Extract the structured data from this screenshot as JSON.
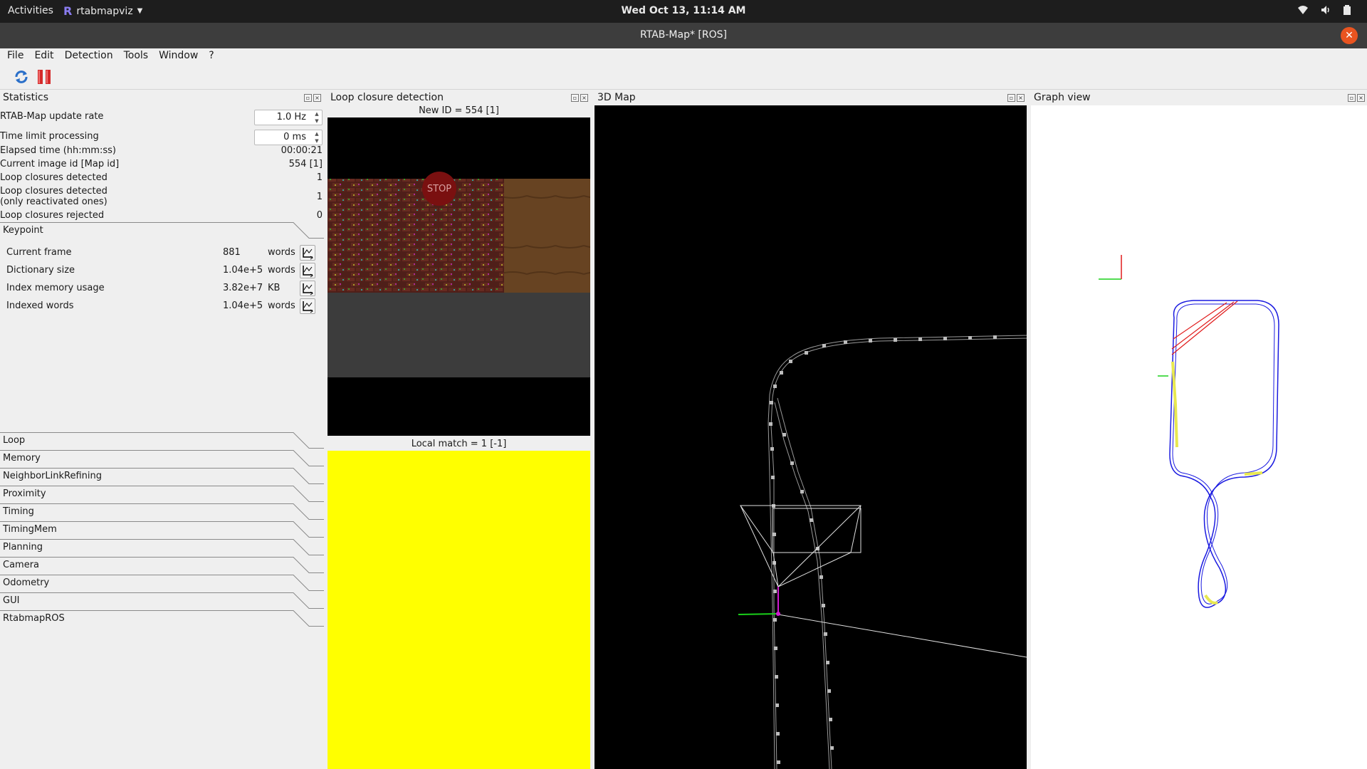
{
  "topbar": {
    "activities": "Activities",
    "app_name": "rtabmapviz",
    "clock": "Wed Oct 13, 11:14 AM"
  },
  "window": {
    "title": "RTAB-Map* [ROS]"
  },
  "menu": {
    "items": [
      "File",
      "Edit",
      "Detection",
      "Tools",
      "Window",
      "?"
    ]
  },
  "toolbar": {
    "refresh_icon": "refresh-icon",
    "pause_icon": "pause-icon"
  },
  "panels": {
    "statistics": "Statistics",
    "loop_closure": "Loop closure detection",
    "map3d": "3D Map",
    "graph": "Graph view"
  },
  "stats": {
    "update_rate_label": "RTAB-Map update rate",
    "update_rate_value": "1.0 Hz",
    "time_limit_label": "Time limit processing",
    "time_limit_value": "0 ms",
    "elapsed_label": "Elapsed time (hh:mm:ss)",
    "elapsed_value": "00:00:21",
    "image_id_label": "Current image id [Map id]",
    "image_id_value": "554 [1]",
    "loops_detected_label": "Loop closures detected",
    "loops_detected_value": "1",
    "loops_reactivated_label_1": "Loop closures detected",
    "loops_reactivated_label_2": "(only reactivated ones)",
    "loops_reactivated_value": "1",
    "loops_rejected_label": "Loop closures rejected",
    "loops_rejected_value": "0"
  },
  "keypoint": {
    "title": "Keypoint",
    "rows": [
      {
        "name": "Current frame",
        "value": "881",
        "unit": "words"
      },
      {
        "name": "Dictionary size",
        "value": "1.04e+5",
        "unit": "words"
      },
      {
        "name": "Index memory usage",
        "value": "3.82e+7",
        "unit": "KB"
      },
      {
        "name": "Indexed words",
        "value": "1.04e+5",
        "unit": "words"
      }
    ]
  },
  "sections": [
    "Loop",
    "Memory",
    "NeighborLinkRefining",
    "Proximity",
    "Timing",
    "TimingMem",
    "Planning",
    "Camera",
    "Odometry",
    "GUI",
    "RtabmapROS"
  ],
  "loop_closure": {
    "new_caption": "New ID = 554 [1]",
    "match_caption": "Local match = 1 [-1]",
    "sign_text": "STOP"
  },
  "colors": {
    "match_fill": "#ffff00",
    "graph_line": "#1a1ae0",
    "loop_link": "#e01a1a"
  }
}
